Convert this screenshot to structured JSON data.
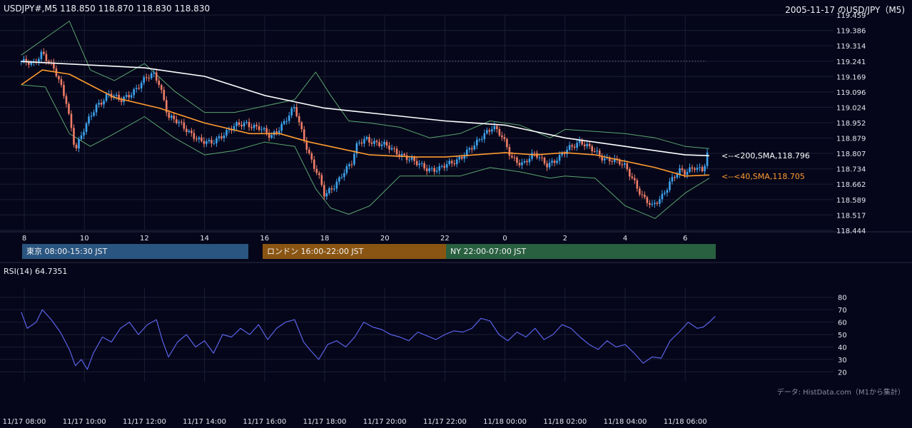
{
  "header": {
    "symbol_ohlc": "USDJPY#,M5 118.850 118.870 118.830 118.830",
    "title": "2005-11-17 のUSD/JPY（M5)"
  },
  "sessions": {
    "tokyo": "東京 08:00-15:30 JST",
    "london": "ロンドン 16:00-22:00 JST",
    "ny": "NY 22:00-07:00 JST"
  },
  "indicators": {
    "ma200_label": "<--<200,SMA,118.796",
    "ma40_label": "<--<40,SMA,118.705",
    "rsi_label": "RSI(14) 64.7351"
  },
  "credit": "データ: HistData.com（M1から集計）",
  "colors": {
    "background": "#05061a",
    "grid": "#1c1e33",
    "candle_up": "#3ea4ee",
    "candle_down": "#f07d66",
    "sma200": "#ffffff",
    "sma40": "#ff9b2f",
    "bollinger": "#5aa66e",
    "rsi_line": "#5a63e8",
    "tokyo": "#2a5580",
    "london": "#8a5512",
    "ny": "#296040"
  },
  "chart_data": [
    {
      "type": "candlestick",
      "pair": "USD/JPY",
      "timeframe": "M5",
      "y_ticks": [
        "119.459",
        "119.386",
        "119.314",
        "119.241",
        "119.169",
        "119.096",
        "119.024",
        "118.952",
        "118.879",
        "118.807",
        "118.734",
        "118.662",
        "118.589",
        "118.517",
        "118.444"
      ],
      "ylim": [
        118.444,
        119.459
      ],
      "x_ticks": [
        "8",
        "10",
        "12",
        "14",
        "16",
        "18",
        "20",
        "22",
        "0",
        "2",
        "4",
        "6"
      ],
      "x_start_hour": 7.9,
      "x_end_hour": 30.8,
      "grid": true,
      "dotted_reference_level": 119.241,
      "sma200_last": 118.796,
      "sma40_last": 118.705,
      "close_path": [
        [
          7.9,
          119.24
        ],
        [
          8.3,
          119.22
        ],
        [
          8.6,
          119.29
        ],
        [
          9.0,
          119.2
        ],
        [
          9.4,
          119.05
        ],
        [
          9.7,
          118.83
        ],
        [
          10.0,
          118.92
        ],
        [
          10.4,
          119.03
        ],
        [
          10.8,
          119.09
        ],
        [
          11.2,
          119.05
        ],
        [
          11.6,
          119.1
        ],
        [
          12.0,
          119.15
        ],
        [
          12.3,
          119.18
        ],
        [
          12.5,
          119.14
        ],
        [
          12.8,
          118.98
        ],
        [
          13.2,
          118.94
        ],
        [
          13.6,
          118.9
        ],
        [
          13.9,
          118.86
        ],
        [
          14.2,
          118.85
        ],
        [
          14.6,
          118.9
        ],
        [
          15.0,
          118.93
        ],
        [
          15.4,
          118.95
        ],
        [
          15.8,
          118.93
        ],
        [
          16.2,
          118.88
        ],
        [
          16.6,
          118.95
        ],
        [
          17.0,
          119.02
        ],
        [
          17.2,
          118.92
        ],
        [
          17.5,
          118.8
        ],
        [
          17.8,
          118.7
        ],
        [
          18.0,
          118.6
        ],
        [
          18.3,
          118.65
        ],
        [
          18.6,
          118.72
        ],
        [
          18.9,
          118.76
        ],
        [
          19.1,
          118.85
        ],
        [
          19.4,
          118.88
        ],
        [
          19.8,
          118.85
        ],
        [
          20.2,
          118.83
        ],
        [
          20.6,
          118.8
        ],
        [
          21.0,
          118.76
        ],
        [
          21.4,
          118.74
        ],
        [
          21.8,
          118.73
        ],
        [
          22.2,
          118.76
        ],
        [
          22.6,
          118.8
        ],
        [
          23.0,
          118.84
        ],
        [
          23.3,
          118.9
        ],
        [
          23.6,
          118.94
        ],
        [
          23.9,
          118.88
        ],
        [
          24.2,
          118.79
        ],
        [
          24.6,
          118.76
        ],
        [
          25.0,
          118.8
        ],
        [
          25.4,
          118.76
        ],
        [
          25.8,
          118.78
        ],
        [
          26.2,
          118.84
        ],
        [
          26.5,
          118.87
        ],
        [
          26.8,
          118.83
        ],
        [
          27.2,
          118.79
        ],
        [
          27.6,
          118.78
        ],
        [
          28.0,
          118.74
        ],
        [
          28.3,
          118.68
        ],
        [
          28.6,
          118.6
        ],
        [
          28.9,
          118.55
        ],
        [
          29.2,
          118.6
        ],
        [
          29.5,
          118.68
        ],
        [
          29.8,
          118.72
        ],
        [
          30.0,
          118.71
        ],
        [
          30.3,
          118.75
        ],
        [
          30.6,
          118.73
        ],
        [
          30.8,
          118.83
        ]
      ],
      "sma200_path": [
        [
          7.9,
          119.24
        ],
        [
          12,
          119.21
        ],
        [
          14,
          119.17
        ],
        [
          16,
          119.08
        ],
        [
          18,
          119.02
        ],
        [
          20,
          118.99
        ],
        [
          22,
          118.96
        ],
        [
          24,
          118.94
        ],
        [
          26,
          118.88
        ],
        [
          28,
          118.84
        ],
        [
          30,
          118.8
        ],
        [
          30.8,
          118.796
        ]
      ],
      "sma40_path": [
        [
          7.9,
          119.13
        ],
        [
          8.6,
          119.2
        ],
        [
          9.5,
          119.18
        ],
        [
          11,
          119.07
        ],
        [
          12.5,
          119.02
        ],
        [
          14,
          118.95
        ],
        [
          15.5,
          118.9
        ],
        [
          16.5,
          118.9
        ],
        [
          17.5,
          118.86
        ],
        [
          18.5,
          118.83
        ],
        [
          19.5,
          118.8
        ],
        [
          21,
          118.79
        ],
        [
          22,
          118.79
        ],
        [
          23,
          118.8
        ],
        [
          24,
          118.81
        ],
        [
          25,
          118.8
        ],
        [
          26,
          118.81
        ],
        [
          27,
          118.8
        ],
        [
          28,
          118.77
        ],
        [
          29,
          118.74
        ],
        [
          30,
          118.7
        ],
        [
          30.8,
          118.705
        ]
      ],
      "boll_upper_path": [
        [
          7.9,
          119.27
        ],
        [
          8.7,
          119.35
        ],
        [
          9.5,
          119.43
        ],
        [
          10.2,
          119.2
        ],
        [
          11,
          119.15
        ],
        [
          12,
          119.23
        ],
        [
          13,
          119.1
        ],
        [
          14,
          119.0
        ],
        [
          15,
          119.0
        ],
        [
          16,
          119.03
        ],
        [
          17,
          119.06
        ],
        [
          17.7,
          119.19
        ],
        [
          18.2,
          119.08
        ],
        [
          18.8,
          118.96
        ],
        [
          19.5,
          118.95
        ],
        [
          20.5,
          118.93
        ],
        [
          21.5,
          118.88
        ],
        [
          22.5,
          118.9
        ],
        [
          23.5,
          118.96
        ],
        [
          24.5,
          118.94
        ],
        [
          25.5,
          118.88
        ],
        [
          26,
          118.92
        ],
        [
          27,
          118.91
        ],
        [
          28,
          118.9
        ],
        [
          29,
          118.88
        ],
        [
          30,
          118.84
        ],
        [
          30.8,
          118.83
        ]
      ],
      "boll_lower_path": [
        [
          7.9,
          119.13
        ],
        [
          8.7,
          119.12
        ],
        [
          9.5,
          118.9
        ],
        [
          10.2,
          118.84
        ],
        [
          11,
          118.9
        ],
        [
          12,
          118.98
        ],
        [
          13,
          118.88
        ],
        [
          14,
          118.8
        ],
        [
          15,
          118.82
        ],
        [
          16,
          118.86
        ],
        [
          17,
          118.84
        ],
        [
          17.7,
          118.64
        ],
        [
          18.2,
          118.55
        ],
        [
          18.8,
          118.52
        ],
        [
          19.5,
          118.56
        ],
        [
          20.5,
          118.7
        ],
        [
          21.5,
          118.7
        ],
        [
          22.5,
          118.7
        ],
        [
          23.5,
          118.74
        ],
        [
          24.5,
          118.72
        ],
        [
          25.5,
          118.69
        ],
        [
          26,
          118.7
        ],
        [
          27,
          118.69
        ],
        [
          28,
          118.56
        ],
        [
          29,
          118.5
        ],
        [
          30,
          118.62
        ],
        [
          30.8,
          118.69
        ]
      ]
    },
    {
      "type": "line",
      "name": "RSI(14)",
      "y_ticks": [
        "80",
        "70",
        "60",
        "50",
        "40",
        "30",
        "20"
      ],
      "ylim": [
        15,
        85
      ],
      "last_value": 64.7351,
      "grid": true,
      "x_tick_labels": [
        "11/17 08:00",
        "11/17 10:00",
        "11/17 12:00",
        "11/17 14:00",
        "11/17 16:00",
        "11/17 18:00",
        "11/17 20:00",
        "11/17 22:00",
        "11/18 00:00",
        "11/18 02:00",
        "11/18 04:00",
        "11/18 06:00"
      ],
      "path": [
        [
          7.9,
          68
        ],
        [
          8.1,
          55
        ],
        [
          8.4,
          60
        ],
        [
          8.6,
          70
        ],
        [
          8.9,
          62
        ],
        [
          9.2,
          52
        ],
        [
          9.5,
          38
        ],
        [
          9.7,
          25
        ],
        [
          9.9,
          30
        ],
        [
          10.1,
          22
        ],
        [
          10.3,
          35
        ],
        [
          10.6,
          48
        ],
        [
          10.9,
          44
        ],
        [
          11.2,
          55
        ],
        [
          11.5,
          60
        ],
        [
          11.8,
          50
        ],
        [
          12.1,
          58
        ],
        [
          12.4,
          62
        ],
        [
          12.6,
          45
        ],
        [
          12.8,
          32
        ],
        [
          13.1,
          44
        ],
        [
          13.4,
          50
        ],
        [
          13.7,
          40
        ],
        [
          14.0,
          45
        ],
        [
          14.3,
          35
        ],
        [
          14.6,
          50
        ],
        [
          14.9,
          48
        ],
        [
          15.2,
          55
        ],
        [
          15.5,
          50
        ],
        [
          15.8,
          58
        ],
        [
          16.1,
          46
        ],
        [
          16.4,
          55
        ],
        [
          16.7,
          60
        ],
        [
          17.0,
          62
        ],
        [
          17.3,
          44
        ],
        [
          17.5,
          38
        ],
        [
          17.8,
          30
        ],
        [
          18.1,
          42
        ],
        [
          18.4,
          45
        ],
        [
          18.7,
          40
        ],
        [
          19.0,
          48
        ],
        [
          19.3,
          60
        ],
        [
          19.6,
          56
        ],
        [
          19.9,
          54
        ],
        [
          20.2,
          50
        ],
        [
          20.5,
          48
        ],
        [
          20.8,
          45
        ],
        [
          21.1,
          52
        ],
        [
          21.4,
          49
        ],
        [
          21.7,
          46
        ],
        [
          22.0,
          50
        ],
        [
          22.3,
          53
        ],
        [
          22.6,
          52
        ],
        [
          22.9,
          55
        ],
        [
          23.2,
          63
        ],
        [
          23.5,
          61
        ],
        [
          23.8,
          50
        ],
        [
          24.1,
          45
        ],
        [
          24.4,
          52
        ],
        [
          24.7,
          48
        ],
        [
          25.0,
          55
        ],
        [
          25.3,
          46
        ],
        [
          25.6,
          50
        ],
        [
          25.9,
          58
        ],
        [
          26.2,
          55
        ],
        [
          26.5,
          48
        ],
        [
          26.8,
          42
        ],
        [
          27.1,
          38
        ],
        [
          27.4,
          45
        ],
        [
          27.7,
          40
        ],
        [
          28.0,
          42
        ],
        [
          28.3,
          35
        ],
        [
          28.6,
          27
        ],
        [
          28.9,
          32
        ],
        [
          29.2,
          31
        ],
        [
          29.5,
          45
        ],
        [
          29.8,
          52
        ],
        [
          30.1,
          60
        ],
        [
          30.4,
          55
        ],
        [
          30.6,
          56
        ],
        [
          30.8,
          60
        ],
        [
          31.0,
          64.7
        ]
      ]
    }
  ]
}
